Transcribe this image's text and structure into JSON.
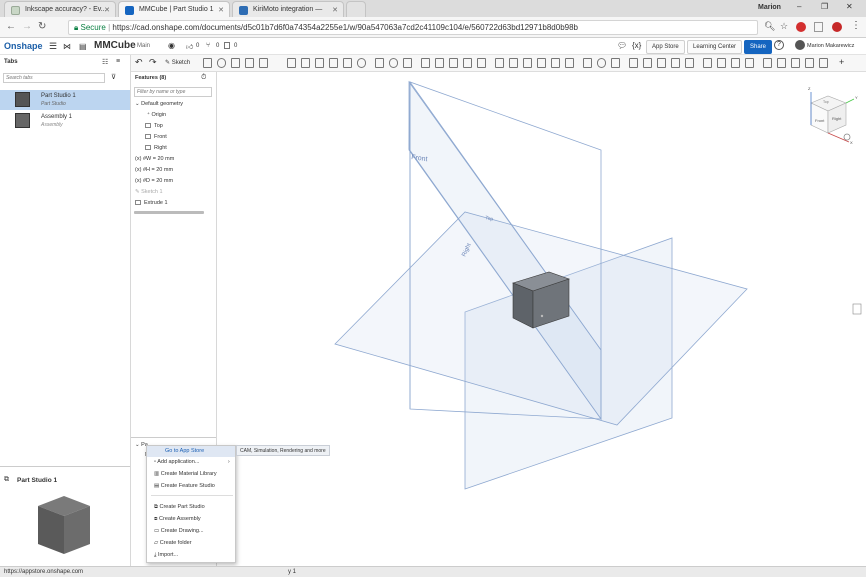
{
  "browser": {
    "tabs": [
      {
        "label": "Inkscape accuracy? - Ev..."
      },
      {
        "label": "MMCube | Part Studio 1"
      },
      {
        "label": "KiriMoto integration —"
      }
    ],
    "user": "Marion",
    "secure_label": "Secure",
    "url": "https://cad.onshape.com/documents/d5c01b7d6f0a74354a2255e1/w/90a547063a7cd2c41109c104/e/560722d63bd12971b8d0b98b"
  },
  "onshape": {
    "logo": "Onshape",
    "doc_title": "MMCube",
    "branch": "Main",
    "likes": "0",
    "versions": "0",
    "copies": "0",
    "app_store": "App Store",
    "learning_center": "Learning Center",
    "share": "Share",
    "help": "?",
    "user_name": "Marion Makarewicz"
  },
  "toolbar": {
    "sketch": "Sketch"
  },
  "left": {
    "tabs_title": "Tabs",
    "search_placeholder": "Search tabs",
    "items": [
      {
        "name": "Part Studio 1",
        "sub": "Part Studio"
      },
      {
        "name": "Assembly 1",
        "sub": "Assembly"
      }
    ],
    "preview_title": "Part Studio 1"
  },
  "features": {
    "title": "Features (8)",
    "filter_placeholder": "Filter by name or type",
    "default_geometry": "Default geometry",
    "origin": "Origin",
    "top": "Top",
    "front": "Front",
    "right": "Right",
    "var1": "#W = 20 mm",
    "var2": "#H = 20 mm",
    "var3": "#D = 20 mm",
    "sketch": "Sketch 1",
    "extrude": "Extrude 1",
    "parts_label": "Pa",
    "parts_sub": "N"
  },
  "menu": {
    "items": [
      "Go to App Store",
      "Add application...",
      "Create Material Library",
      "Create Feature Studio",
      "Create Part Studio",
      "Create Assembly",
      "Create Drawing...",
      "Create folder",
      "Import..."
    ],
    "submenu_text": "CAM, Simulation, Rendering and more"
  },
  "viewport": {
    "plane_front": "Front",
    "plane_top": "Top",
    "plane_right": "Right",
    "cube_front": "Front",
    "cube_right": "Right",
    "cube_top": "Top",
    "axis_z": "Z",
    "axis_x": "X",
    "axis_y": "Y"
  },
  "status": {
    "url": "https://appstore.onshape.com",
    "fragment": "y 1"
  }
}
